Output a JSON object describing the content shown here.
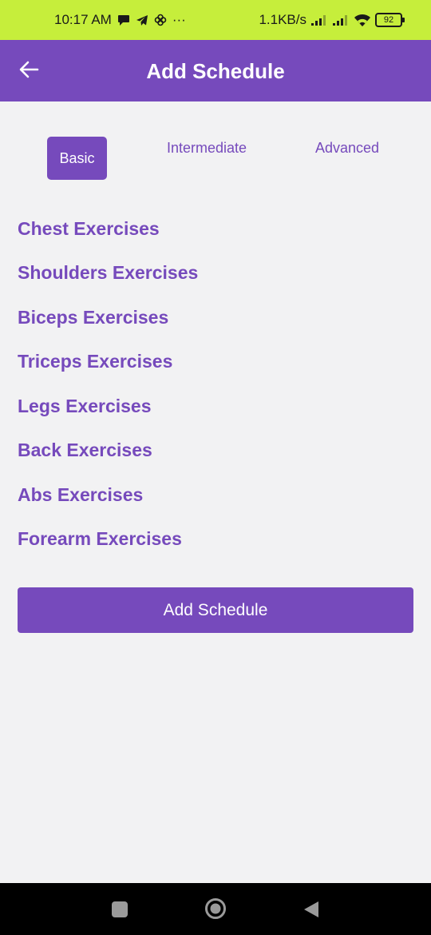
{
  "status_bar": {
    "time": "10:17 AM",
    "more": "···",
    "speed": "1.1KB/s",
    "battery": "92",
    "icons": [
      "message-icon",
      "telegram-icon",
      "pinwheel-icon",
      "signal-icon",
      "signal-icon",
      "wifi-icon",
      "battery-icon"
    ]
  },
  "app_bar": {
    "title": "Add Schedule",
    "back_icon": "arrow-left-icon"
  },
  "tabs": [
    {
      "label": "Basic",
      "active": true
    },
    {
      "label": "Intermediate",
      "active": false
    },
    {
      "label": "Advanced",
      "active": false
    }
  ],
  "exercises": [
    "Chest Exercises",
    "Shoulders Exercises",
    "Biceps Exercises",
    "Triceps Exercises",
    "Legs Exercises",
    "Back Exercises",
    "Abs Exercises",
    "Forearm Exercises"
  ],
  "add_button": {
    "label": "Add Schedule"
  },
  "nav_bar": {
    "icons": [
      "recents-icon",
      "home-icon",
      "back-icon"
    ]
  },
  "colors": {
    "accent": "#764abc",
    "status_bar": "#c6ee3b",
    "background": "#f2f2f3"
  }
}
